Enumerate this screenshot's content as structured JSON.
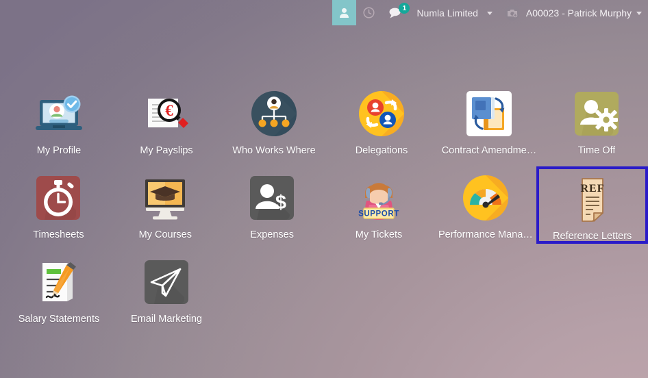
{
  "topbar": {
    "user_icon_name": "user-icon",
    "clock_icon_name": "clock-icon",
    "messages_icon_name": "messages-icon",
    "messages_badge": "1",
    "company": "Numla Limited",
    "user": "A00023 - Patrick Murphy",
    "active_bg": "#83c5c9",
    "badge_color": "#15a89a"
  },
  "highlight": {
    "app": "Reference Letters",
    "border_color": "#2a1bc8"
  },
  "apps": [
    {
      "label": "My Profile",
      "icon": "my-profile-icon"
    },
    {
      "label": "My Payslips",
      "icon": "my-payslips-icon"
    },
    {
      "label": "Who Works Where",
      "icon": "who-works-where-icon"
    },
    {
      "label": "Delegations",
      "icon": "delegations-icon"
    },
    {
      "label": "Contract Amendme…",
      "icon": "contract-amendments-icon"
    },
    {
      "label": "Time Off",
      "icon": "time-off-icon"
    },
    {
      "label": "Timesheets",
      "icon": "timesheets-icon"
    },
    {
      "label": "My Courses",
      "icon": "my-courses-icon"
    },
    {
      "label": "Expenses",
      "icon": "expenses-icon"
    },
    {
      "label": "My Tickets",
      "icon": "my-tickets-icon"
    },
    {
      "label": "Performance Mana…",
      "icon": "performance-management-icon"
    },
    {
      "label": "Reference Letters",
      "icon": "reference-letters-icon"
    },
    {
      "label": "Salary Statements",
      "icon": "salary-statements-icon"
    },
    {
      "label": "Email Marketing",
      "icon": "email-marketing-icon"
    }
  ],
  "icon_text": {
    "my_tickets_badge": "SUPPORT",
    "reference_letters_header": "REF",
    "payslip_currency": "€"
  }
}
